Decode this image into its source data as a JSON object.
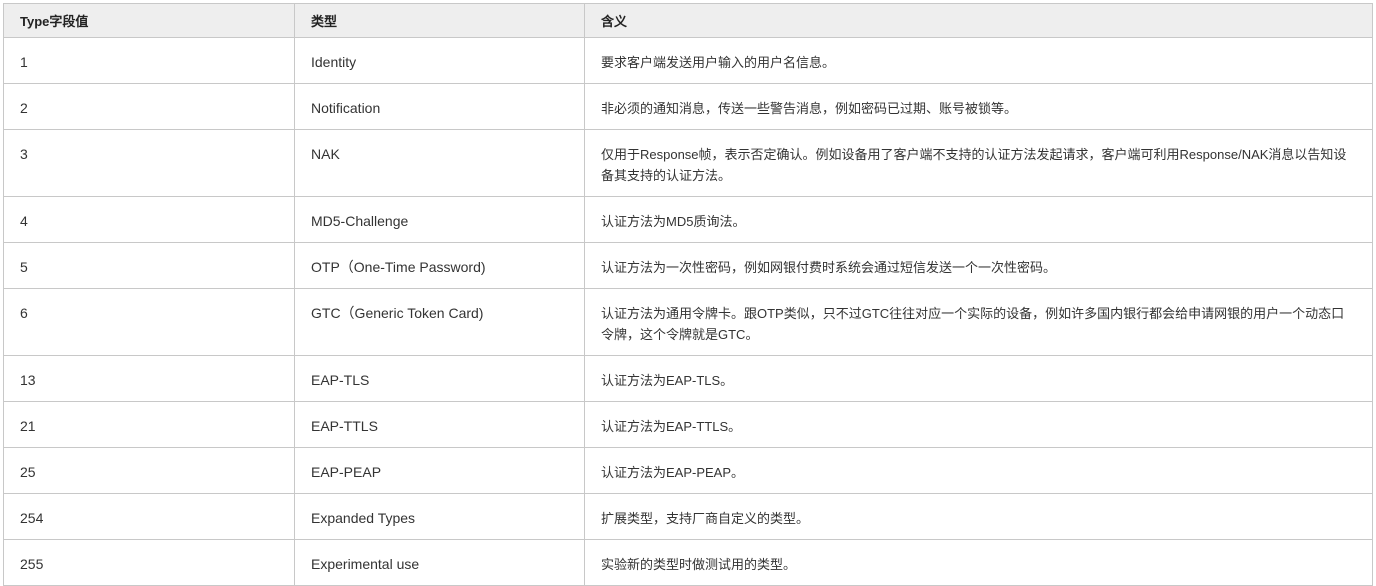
{
  "table": {
    "headers": [
      "Type字段值",
      "类型",
      "含义"
    ],
    "rows": [
      {
        "value": "1",
        "type": "Identity",
        "meaning": "要求客户端发送用户输入的用户名信息。"
      },
      {
        "value": "2",
        "type": "Notification",
        "meaning": "非必须的通知消息，传送一些警告消息，例如密码已过期、账号被锁等。"
      },
      {
        "value": "3",
        "type": "NAK",
        "meaning": "仅用于Response帧，表示否定确认。例如设备用了客户端不支持的认证方法发起请求，客户端可利用Response/NAK消息以告知设备其支持的认证方法。"
      },
      {
        "value": "4",
        "type": "MD5-Challenge",
        "meaning": "认证方法为MD5质询法。"
      },
      {
        "value": "5",
        "type": "OTP（One-Time Password)",
        "meaning": "认证方法为一次性密码，例如网银付费时系统会通过短信发送一个一次性密码。"
      },
      {
        "value": "6",
        "type": "GTC（Generic Token Card)",
        "meaning": "认证方法为通用令牌卡。跟OTP类似，只不过GTC往往对应一个实际的设备，例如许多国内银行都会给申请网银的用户一个动态口令牌，这个令牌就是GTC。"
      },
      {
        "value": "13",
        "type": "EAP-TLS",
        "meaning": "认证方法为EAP-TLS。"
      },
      {
        "value": "21",
        "type": "EAP-TTLS",
        "meaning": "认证方法为EAP-TTLS。"
      },
      {
        "value": "25",
        "type": "EAP-PEAP",
        "meaning": "认证方法为EAP-PEAP。"
      },
      {
        "value": "254",
        "type": "Expanded Types",
        "meaning": "扩展类型，支持厂商自定义的类型。"
      },
      {
        "value": "255",
        "type": "Experimental use",
        "meaning": "实验新的类型时做测试用的类型。"
      }
    ]
  }
}
